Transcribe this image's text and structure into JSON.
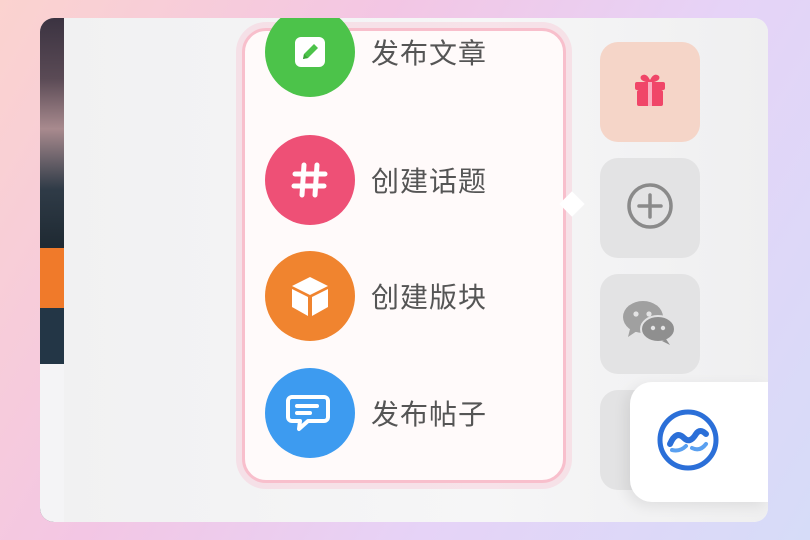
{
  "menu": {
    "items": [
      {
        "label": "发布文章",
        "icon": "pencil-icon",
        "color": "#4cc34a"
      },
      {
        "label": "创建话题",
        "icon": "hash-icon",
        "color": "#ee5076"
      },
      {
        "label": "创建版块",
        "icon": "cube-icon",
        "color": "#f0842f"
      },
      {
        "label": "发布帖子",
        "icon": "chat-bubble-icon",
        "color": "#3d9bf0"
      }
    ]
  },
  "sidebar": {
    "buttons": [
      {
        "icon": "gift-icon",
        "bg": "#f5d5c8",
        "color": "#f04668"
      },
      {
        "icon": "plus-circle-icon",
        "bg": "#e3e3e4",
        "color": "#8a8a8a"
      },
      {
        "icon": "wechat-icon",
        "bg": "#e3e3e4",
        "color": "#9a9a9a"
      }
    ],
    "logo": {
      "icon": "app-logo-icon",
      "color": "#2b6fd8"
    }
  }
}
